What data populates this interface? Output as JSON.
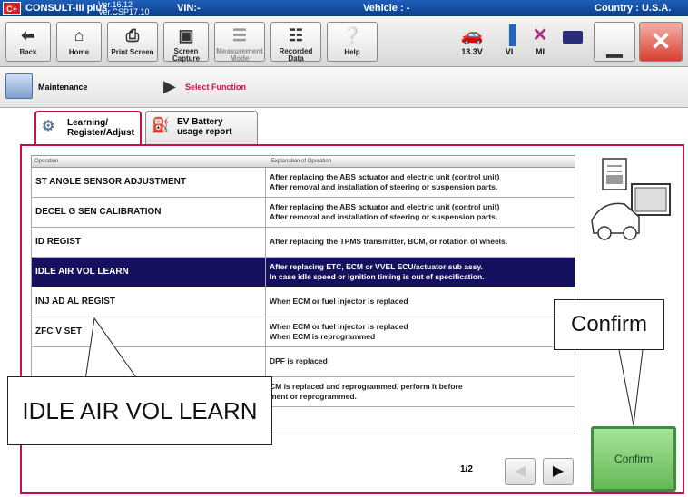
{
  "titlebar": {
    "logo_text": "C+",
    "app_name": "CONSULT-III plus",
    "ver1": "Ver.16.12",
    "ver2": "Ver.CSP17.10",
    "vin": "VIN:-",
    "vehicle": "Vehicle : -",
    "country": "Country : U.S.A."
  },
  "toolbar": {
    "back": "Back",
    "home": "Home",
    "print_screen": "Print Screen",
    "screen_capture": "Screen Capture",
    "measurement_mode": "Measurement Mode",
    "recorded_data": "Recorded Data",
    "help": "Help",
    "voltage": "13.3V",
    "vi": "VI",
    "mi": "MI"
  },
  "breadcrumb": {
    "home": "Maintenance",
    "current": "Select Function"
  },
  "tabs": [
    {
      "label": "Learning/ Register/Adjust"
    },
    {
      "label": "EV Battery usage report"
    }
  ],
  "table": {
    "col_operation": "Operation",
    "col_explanation": "Explanation of Operation",
    "rows": [
      {
        "op": "ST ANGLE SENSOR ADJUSTMENT",
        "ex1": "After replacing the ABS actuator and electric unit (control unit)",
        "ex2": "After removal and installation of steering or suspension parts."
      },
      {
        "op": "DECEL G SEN CALIBRATION",
        "ex1": "After replacing the ABS actuator and electric unit (control unit)",
        "ex2": "After removal and installation of steering or suspension parts."
      },
      {
        "op": "ID REGIST",
        "ex1": "After replacing the TPMS transmitter, BCM, or rotation of wheels.",
        "ex2": ""
      },
      {
        "op": "IDLE AIR VOL LEARN",
        "ex1": "After replacing ETC, ECM or VVEL ECU/actuator sub assy.",
        "ex2": "In case idle speed or ignition timing is out of specification."
      },
      {
        "op": "INJ AD    AL REGIST",
        "ex1": "When ECM or fuel injector is replaced",
        "ex2": ""
      },
      {
        "op": "ZFC V       SET",
        "ex1": "When ECM or fuel injector is replaced",
        "ex2": "When ECM is reprogrammed"
      },
      {
        "op": "",
        "ex1": "     DPF is replaced",
        "ex2": ""
      },
      {
        "op": "",
        "ex1": "     CM is replaced and reprogrammed, perform it before",
        "ex2": "     ment or reprogrammed."
      }
    ]
  },
  "callouts": {
    "confirm": "Confirm",
    "idle": "IDLE AIR VOL LEARN"
  },
  "confirm_button": "Confirm",
  "pager": "1/2"
}
